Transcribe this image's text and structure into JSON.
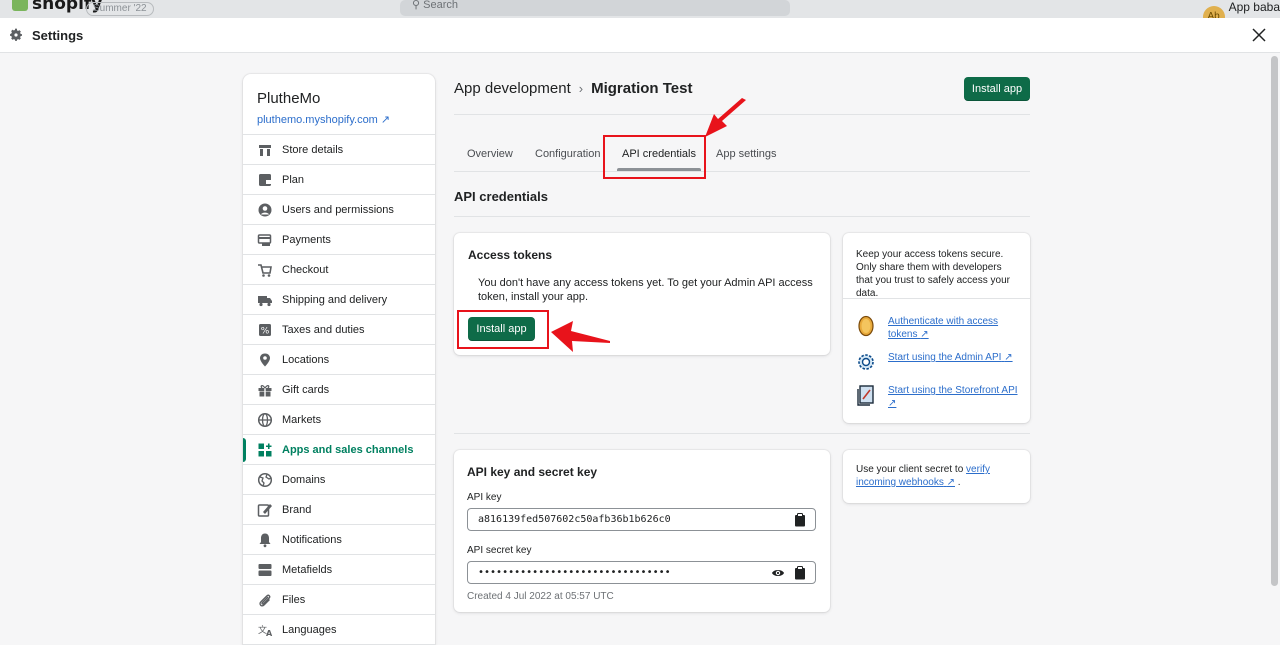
{
  "topbar": {
    "logo": "shopify",
    "badge": "Summer '22",
    "search_placeholder": "Search",
    "account_initials": "Ab",
    "account_name": "App baba"
  },
  "settings": {
    "title": "Settings"
  },
  "store": {
    "name": "PlutheMo",
    "url": "pluthemo.myshopify.com"
  },
  "nav": {
    "items": [
      {
        "label": "Store details",
        "icon": "store-icon"
      },
      {
        "label": "Plan",
        "icon": "plan-icon"
      },
      {
        "label": "Users and permissions",
        "icon": "user-icon"
      },
      {
        "label": "Payments",
        "icon": "payments-icon"
      },
      {
        "label": "Checkout",
        "icon": "cart-icon"
      },
      {
        "label": "Shipping and delivery",
        "icon": "truck-icon"
      },
      {
        "label": "Taxes and duties",
        "icon": "tax-icon"
      },
      {
        "label": "Locations",
        "icon": "location-pin-icon"
      },
      {
        "label": "Gift cards",
        "icon": "gift-icon"
      },
      {
        "label": "Markets",
        "icon": "globe-icon"
      },
      {
        "label": "Apps and sales channels",
        "icon": "apps-icon",
        "active": true
      },
      {
        "label": "Domains",
        "icon": "domains-globe-icon"
      },
      {
        "label": "Brand",
        "icon": "brand-icon"
      },
      {
        "label": "Notifications",
        "icon": "bell-icon"
      },
      {
        "label": "Metafields",
        "icon": "metafields-icon"
      },
      {
        "label": "Files",
        "icon": "paperclip-icon"
      },
      {
        "label": "Languages",
        "icon": "translate-icon"
      }
    ]
  },
  "page": {
    "breadcrumb_parent": "App development",
    "breadcrumb_current": "Migration Test",
    "install_label": "Install app",
    "tabs": [
      "Overview",
      "Configuration",
      "API credentials",
      "App settings"
    ],
    "active_tab": "API credentials",
    "section_title": "API credentials"
  },
  "access_tokens": {
    "title": "Access tokens",
    "description": "You don't have any access tokens yet. To get your Admin API access token, install your app.",
    "button": "Install app"
  },
  "tips": {
    "note": "Keep your access tokens secure. Only share them with developers that you trust to safely access your data.",
    "links": [
      {
        "label": "Authenticate with access tokens",
        "icon": "token-coin-icon"
      },
      {
        "label": "Start using the Admin API",
        "icon": "gear-cog-icon"
      },
      {
        "label": "Start using the Storefront API",
        "icon": "storefront-doc-icon"
      }
    ]
  },
  "keys": {
    "title": "API key and secret key",
    "api_key_label": "API key",
    "api_key_value": "a816139fed507602c50afb36b1b626c0",
    "secret_label": "API secret key",
    "secret_value": "••••••••••••••••••••••••••••••••",
    "created": "Created 4 Jul 2022 at 05:57 UTC"
  },
  "webhook_note": {
    "prefix": "Use your client secret to ",
    "link": "verify incoming webhooks",
    "suffix": " ."
  },
  "colors": {
    "primary": "#0e6b48",
    "active_nav": "#008060",
    "link": "#2c6ecb",
    "annotation_red": "#e8131b"
  }
}
